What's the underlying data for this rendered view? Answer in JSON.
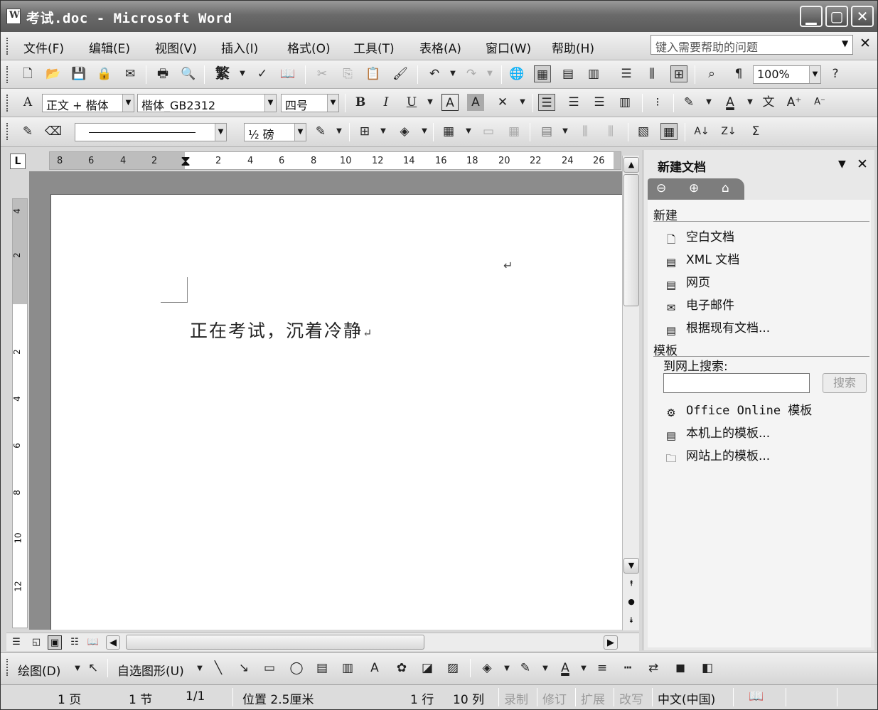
{
  "window": {
    "title": "考试.doc - Microsoft Word",
    "min": "▁",
    "max": "▢",
    "close": "✕"
  },
  "menu": {
    "items": [
      "文件(F)",
      "编辑(E)",
      "视图(V)",
      "插入(I)",
      "格式(O)",
      "工具(T)",
      "表格(A)",
      "窗口(W)",
      "帮助(H)"
    ],
    "help_placeholder": "键入需要帮助的问题"
  },
  "standard_toolbar": {
    "zoom": "100%",
    "traditional_label": "繁"
  },
  "format_toolbar": {
    "style": "正文 + 楷体",
    "font": "楷体_GB2312",
    "size": "四号",
    "bold": "B",
    "italic": "I",
    "underline": "U"
  },
  "tables_toolbar": {
    "line_weight": "½ 磅"
  },
  "ruler": {
    "h_numbers": [
      "8",
      "6",
      "4",
      "2",
      "2",
      "4",
      "6",
      "8",
      "10",
      "12",
      "14",
      "16",
      "18",
      "20",
      "22",
      "24",
      "26"
    ],
    "v_numbers": [
      "4",
      "2",
      "2",
      "4",
      "6",
      "8",
      "10",
      "12"
    ]
  },
  "document": {
    "text": "正在考试，沉着冷静",
    "para_mark": "↵"
  },
  "task_pane": {
    "title": "新建文档",
    "section_new": "新建",
    "new_items": [
      "空白文档",
      "XML 文档",
      "网页",
      "电子邮件",
      "根据现有文档..."
    ],
    "section_templates": "模板",
    "search_label": "到网上搜索:",
    "search_button": "搜索",
    "template_items": [
      "Office Online 模板",
      "本机上的模板...",
      "网站上的模板..."
    ]
  },
  "draw_bar": {
    "draw": "绘图(D)",
    "autoshapes": "自选图形(U)"
  },
  "status": {
    "page": "1 页",
    "section": "1 节",
    "pages": "1/1",
    "position": "位置 2.5厘米",
    "line": "1 行",
    "column": "10 列",
    "rec": "录制",
    "trk": "修订",
    "ext": "扩展",
    "ovr": "改写",
    "language": "中文(中国)"
  }
}
